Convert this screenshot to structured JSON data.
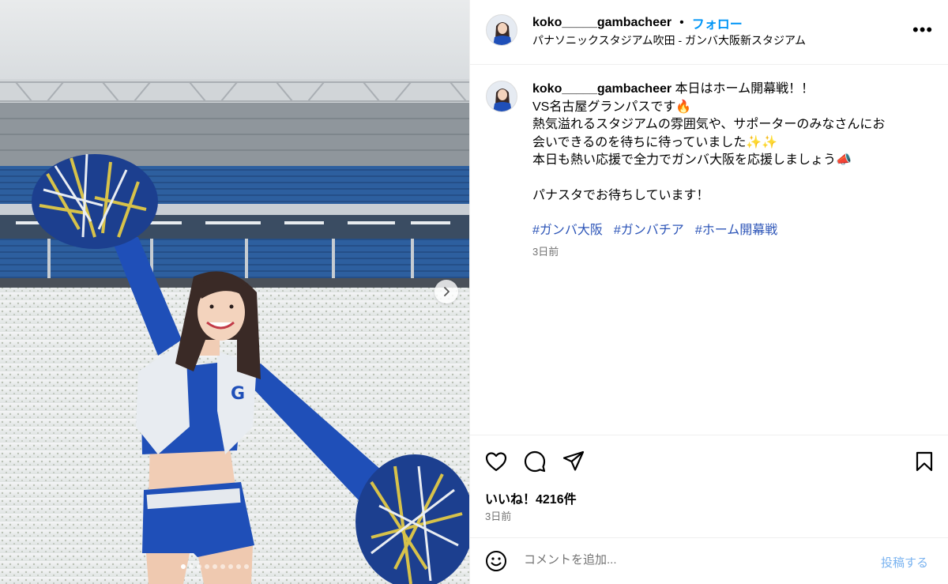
{
  "post": {
    "username": "koko_____gambacheer",
    "follow_label": "フォロー",
    "location": "パナソニックスタジアム吹田 - ガンバ大阪新スタジアム",
    "more_label": "•••"
  },
  "caption": {
    "username": "koko_____gambacheer",
    "line1": " 本日はホーム開幕戦！！",
    "line2": "VS名古屋グランパスです🔥",
    "line3": "熱気溢れるスタジアムの雰囲気や、サポーターのみなさんにお",
    "line4": "会いできるのを待ちに待っていました✨✨",
    "line5": "本日も熱い応援で全力でガンバ大阪を応援しましょう📣",
    "line6": "パナスタでお待ちしています！",
    "hashtags": [
      "#ガンバ大阪",
      "#ガンバチア",
      "#ホーム開幕戦"
    ],
    "time": "3日前"
  },
  "engagement": {
    "likes": "いいね！4216件",
    "time": "3日前"
  },
  "comment": {
    "placeholder": "コメントを追加...",
    "post_label": "投稿する"
  },
  "carousel": {
    "slide_count": 9,
    "active_index": 0
  },
  "colors": {
    "accent": "#0095f6",
    "hashtag": "#2e56b8",
    "muted": "#737373",
    "team_blue": "#1f4fb8"
  }
}
